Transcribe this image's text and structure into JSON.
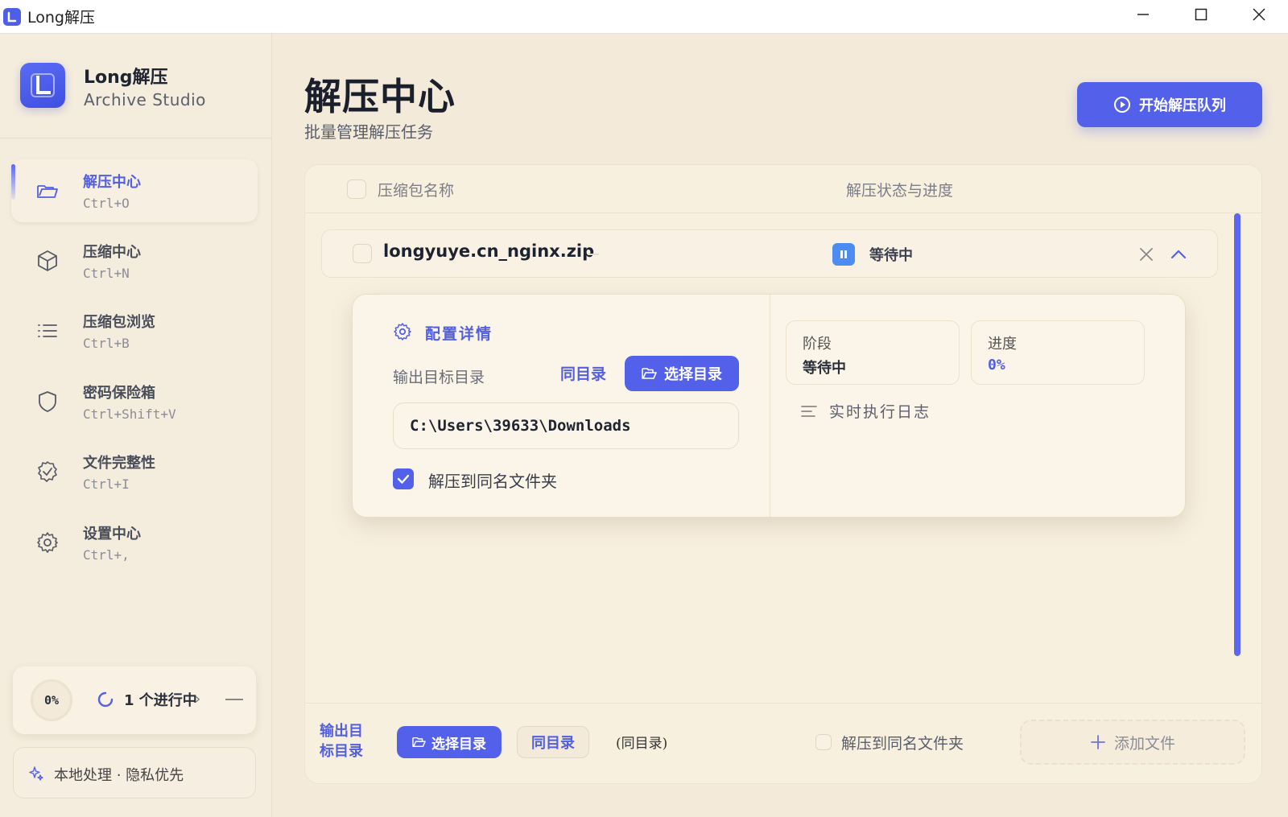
{
  "window": {
    "title": "Long解压",
    "controls": [
      "minimize-icon",
      "maximize-icon",
      "close-icon"
    ]
  },
  "brand": {
    "name": "Long解压",
    "subtitle": "Archive Studio",
    "logo_letter": "L"
  },
  "nav": {
    "items": [
      {
        "label": "解压中心",
        "shortcut": "Ctrl+O",
        "icon": "folder-open-icon",
        "active": true
      },
      {
        "label": "压缩中心",
        "shortcut": "Ctrl+N",
        "icon": "box-icon"
      },
      {
        "label": "压缩包浏览",
        "shortcut": "Ctrl+B",
        "icon": "list-icon"
      },
      {
        "label": "密码保险箱",
        "shortcut": "Ctrl+Shift+V",
        "icon": "shield-icon"
      },
      {
        "label": "文件完整性",
        "shortcut": "Ctrl+I",
        "icon": "check-circle-icon"
      },
      {
        "label": "设置中心",
        "shortcut": "Ctrl+,",
        "icon": "gear-icon"
      }
    ]
  },
  "progress_card": {
    "percent_text": "0%",
    "running_text": "1 个进行中",
    "arrow": "›"
  },
  "privacy": {
    "text": "本地处理 · 隐私优先"
  },
  "header": {
    "title": "解压中心",
    "subtitle": "批量管理解压任务",
    "start_button": "开始解压队列"
  },
  "table": {
    "col_name": "压缩包名称",
    "col_status": "解压状态与进度"
  },
  "task": {
    "name": "longyuye.cn_nginx.zip",
    "status": "等待中",
    "detail": {
      "heading": "配置详情",
      "output_label": "输出目标目录",
      "same_dir": "同目录",
      "choose_dir": "选择目录",
      "path": "C:\\Users\\39633\\Downloads",
      "extract_to_folder_label": "解压到同名文件夹",
      "extract_to_folder_checked": true,
      "stage_label": "阶段",
      "stage_value": "等待中",
      "progress_label": "进度",
      "progress_value": "0%",
      "log_label": "实时执行日志"
    }
  },
  "footer": {
    "output_label": "输出目标目录",
    "choose_dir": "选择目录",
    "same_dir": "同目录",
    "current_dir": "(同目录)",
    "extract_to_folder_label": "解压到同名文件夹",
    "extract_to_folder_checked": false,
    "add_file": "添加文件"
  },
  "colors": {
    "accent": "#5361ea",
    "background": "#f3ead9",
    "status_blue": "#4d8cf0"
  }
}
